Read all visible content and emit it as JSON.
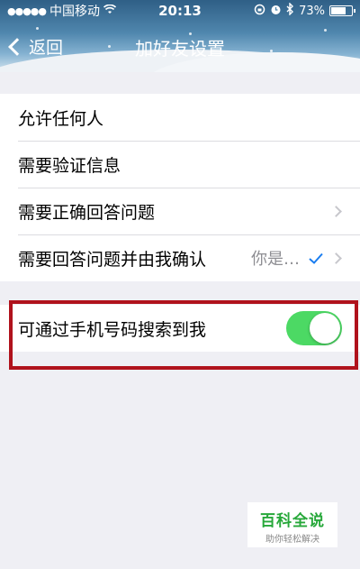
{
  "status_bar": {
    "signal": "●●●●●",
    "carrier": "中国移动",
    "time": "20:13",
    "battery_percent": "73%",
    "battery_level": 0.73
  },
  "nav": {
    "back_label": "返回",
    "title": "加好友设置"
  },
  "options": [
    {
      "label": "允许任何人"
    },
    {
      "label": "需要验证信息"
    },
    {
      "label": "需要正确回答问题"
    },
    {
      "label": "需要回答问题并由我确认",
      "value": "你是…"
    }
  ],
  "phone_search": {
    "label": "可通过手机号码搜索到我",
    "enabled": true
  },
  "watermark": {
    "main": "百科全说",
    "sub": "助你轻松解决"
  },
  "colors": {
    "toggle_on": "#4cd964",
    "check": "#1a7df0",
    "highlight_border": "#b0121c",
    "watermark_green": "#27a83a"
  }
}
